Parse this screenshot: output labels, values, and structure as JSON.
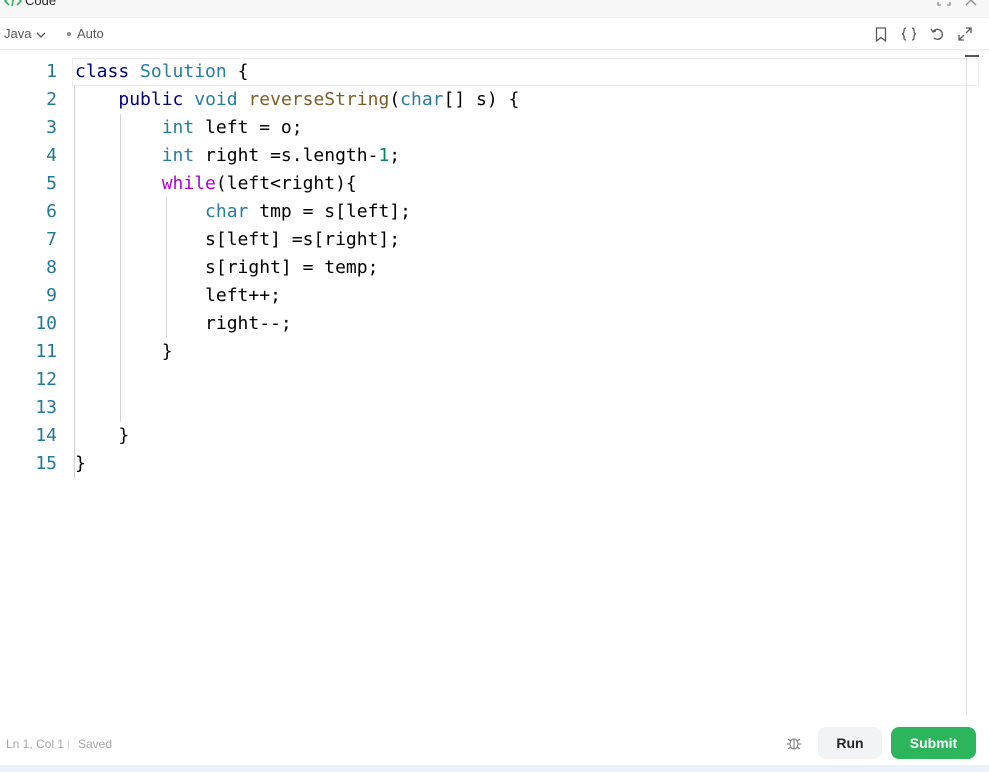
{
  "titlebar": {
    "title": "Code",
    "icons": [
      "code-icon",
      "maximize-icon",
      "close-icon"
    ]
  },
  "toolbar": {
    "language": "Java",
    "mode": "Auto",
    "icons": [
      "bookmark-icon",
      "format-braces-icon",
      "reset-icon",
      "fullscreen-icon"
    ]
  },
  "editor": {
    "line_numbers": [
      "1",
      "2",
      "3",
      "4",
      "5",
      "6",
      "7",
      "8",
      "9",
      "10",
      "11",
      "12",
      "13",
      "14",
      "15"
    ],
    "lines": [
      "class Solution {",
      "    public void reverseString(char[] s) {",
      "        int left = o;",
      "        int right =s.length-1;",
      "        while(left<right){",
      "            char tmp = s[left];",
      "            s[left] =s[right];",
      "            s[right] = temp;",
      "            left++;",
      "            right--;",
      "        }",
      "",
      "",
      "    }",
      "}"
    ]
  },
  "footer": {
    "position": "Ln 1, Col 1",
    "separator": "|",
    "save_status": "Saved",
    "run_label": "Run",
    "submit_label": "Submit"
  },
  "colors": {
    "accent": "#2db55d",
    "line_number": "#237893",
    "keyword": "#000080",
    "type": "#267f99",
    "function": "#795e26",
    "control": "#af00db",
    "number": "#098658"
  }
}
